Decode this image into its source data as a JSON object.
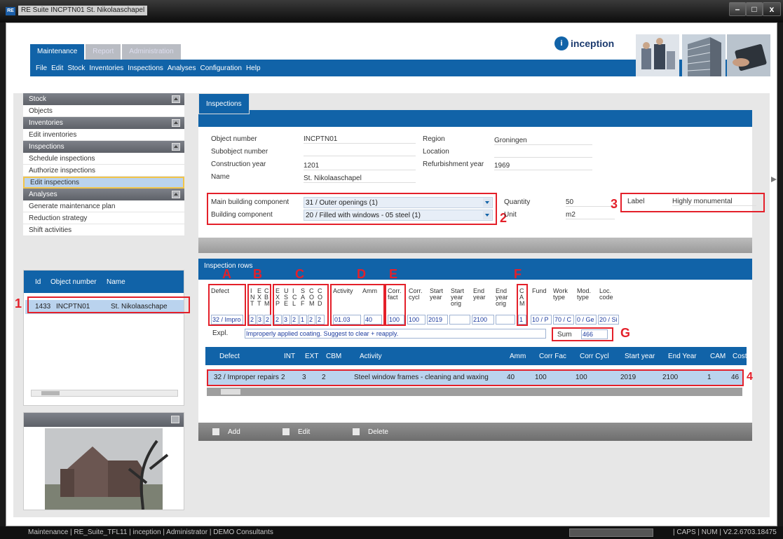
{
  "window": {
    "app_icon": "RE",
    "title": "RE Suite  INCPTN01  St. Nikolaaschapel",
    "minimize": "–",
    "maximize": "□",
    "close": "x"
  },
  "header": {
    "tabs": [
      "Maintenance",
      "Report",
      "Administration"
    ],
    "menu": [
      "File",
      "Edit",
      "Stock",
      "Inventories",
      "Inspections",
      "Analyses",
      "Configuration",
      "Help"
    ],
    "logo_text": "inception",
    "logo_icon": "i"
  },
  "sidebar": {
    "sections": [
      {
        "title": "Stock",
        "items": [
          "Objects"
        ]
      },
      {
        "title": "Inventories",
        "items": [
          "Edit inventories"
        ]
      },
      {
        "title": "Inspections",
        "items": [
          "Schedule inspections",
          "Authorize inspections",
          "Edit inspections"
        ]
      },
      {
        "title": "Analyses",
        "items": [
          "Generate maintenance plan",
          "Reduction strategy",
          "Shift activities"
        ]
      }
    ],
    "selected_item": "Edit inspections",
    "list": {
      "headers": [
        "Id",
        "Object number",
        "Name"
      ],
      "row": [
        "1433",
        "INCPTN01",
        "St. Nikolaaschape"
      ]
    }
  },
  "inspections": {
    "tab_label": "Inspections",
    "fields": {
      "object_number_label": "Object number",
      "object_number": "INCPTN01",
      "subobject_label": "Subobject number",
      "construction_year_label": "Construction year",
      "construction_year": "1201",
      "name_label": "Name",
      "name": "St. Nikolaaschapel",
      "region_label": "Region",
      "region": "Groningen",
      "location_label": "Location",
      "refurb_label": "Refurbishment year",
      "refurb_year": "1969",
      "main_component_label": "Main building component",
      "main_component": "31 / Outer openings (1)",
      "component_label": "Building component",
      "component": "20 / Filled with windows - 05 steel (1)",
      "quantity_label": "Quantity",
      "quantity": "50",
      "unit_label": "Unit",
      "unit": "m2",
      "label_label": "Label",
      "label_value": "Highly monumental"
    },
    "annotations": [
      "1",
      "2",
      "3",
      "4",
      "A",
      "B",
      "C",
      "D",
      "E",
      "F",
      "G"
    ]
  },
  "rows": {
    "title": "Inspection rows",
    "col_headers": {
      "defect": "Defect",
      "int": "I\nN\nT",
      "ext": "E\nX\nT",
      "cbm": "C\nB\nM",
      "eu": "E\nX\nP",
      "us": "U\nS\nE",
      "is": "I\nC\nL",
      "sc": "S\nA\nF",
      "co": "C\nO\nM",
      "cc": "C\nO\nD",
      "activity": "Activity",
      "amm": "Amm",
      "corr_fact": "Corr.\nfact",
      "corr_cycl": "Corr.\ncycl",
      "start_year": "Start\nyear",
      "start_year_orig": "Start\nyear\norig",
      "end_year": "End\nyear",
      "end_year_orig": "End\nyear\norig",
      "cam": "C\nA\nM",
      "fund": "Fund",
      "work_type": "Work\ntype",
      "mod_type": "Mod.\ntype",
      "loc_code": "Loc.\ncode"
    },
    "values": {
      "defect": "32 / Impro",
      "int": "2",
      "ext": "3",
      "cbm": "2",
      "e2": "2",
      "u2": "3",
      "i2": "2",
      "s2": "1",
      "c2a": "2",
      "c2b": "2",
      "activity": "01.03",
      "amm": "40",
      "corr_fact": "100",
      "corr_cycl": "100",
      "start_year": "2019",
      "start_year_orig": "",
      "end_year": "2100",
      "end_year_orig": "",
      "cam": "1",
      "fund": "10 / P",
      "work_type": "70 / C",
      "mod_type": "0 / Ge",
      "loc_code": "20 / Si"
    },
    "expl_label": "Expl.",
    "expl": "Improperly applied coating. Suggest to clear + reapply.",
    "sum_label": "Sum",
    "sum": "466",
    "grid_headers": [
      "Defect",
      "INT",
      "EXT",
      "CBM",
      "Activity",
      "Amm",
      "Corr Fac",
      "Corr Cycl",
      "Start year",
      "End Year",
      "CAM",
      "Cost"
    ],
    "grid_row": [
      "32 / Improper repairs",
      "2",
      "3",
      "2",
      "Steel window frames - cleaning and waxing",
      "40",
      "100",
      "100",
      "2019",
      "2100",
      "1",
      "46"
    ],
    "actions": [
      "Add",
      "Edit",
      "Delete"
    ]
  },
  "status": {
    "left": "Maintenance | RE_Suite_TFL11 | inception | Administrator | DEMO Consultants",
    "right": "| CAPS | NUM | V2.2.6703.18475"
  }
}
